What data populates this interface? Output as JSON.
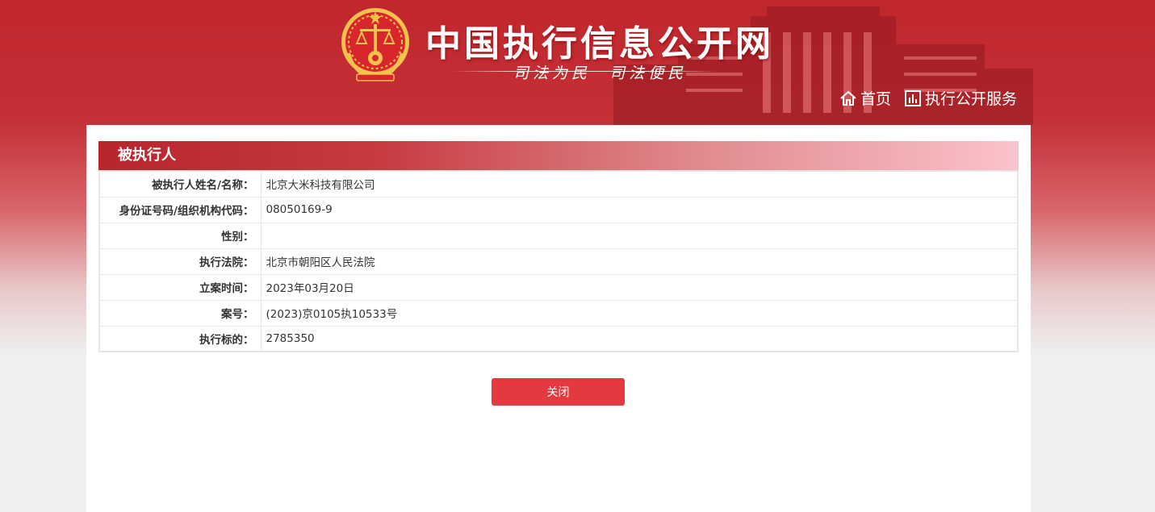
{
  "header": {
    "site_title": "中国执行信息公开网",
    "slogan_left": "司法为民",
    "slogan_right": "司法便民",
    "nav": [
      {
        "icon": "home-icon",
        "label": "首页"
      },
      {
        "icon": "chart-icon",
        "label": "执行公开服务"
      }
    ]
  },
  "panel": {
    "title": "被执行人",
    "rows": [
      {
        "label": "被执行人姓名/名称：",
        "value": "北京大米科技有限公司"
      },
      {
        "label": "身份证号码/组织机构代码：",
        "value": "08050169-9"
      },
      {
        "label": "性别：",
        "value": ""
      },
      {
        "label": "执行法院：",
        "value": "北京市朝阳区人民法院"
      },
      {
        "label": "立案时间：",
        "value": "2023年03月20日"
      },
      {
        "label": "案号：",
        "value": "(2023)京0105执10533号"
      },
      {
        "label": "执行标的：",
        "value": "2785350"
      }
    ],
    "close_label": "关闭"
  },
  "colors": {
    "brand_red": "#c0272d",
    "button_red": "#e23a3f",
    "emblem_gold": "#f2c14e"
  }
}
